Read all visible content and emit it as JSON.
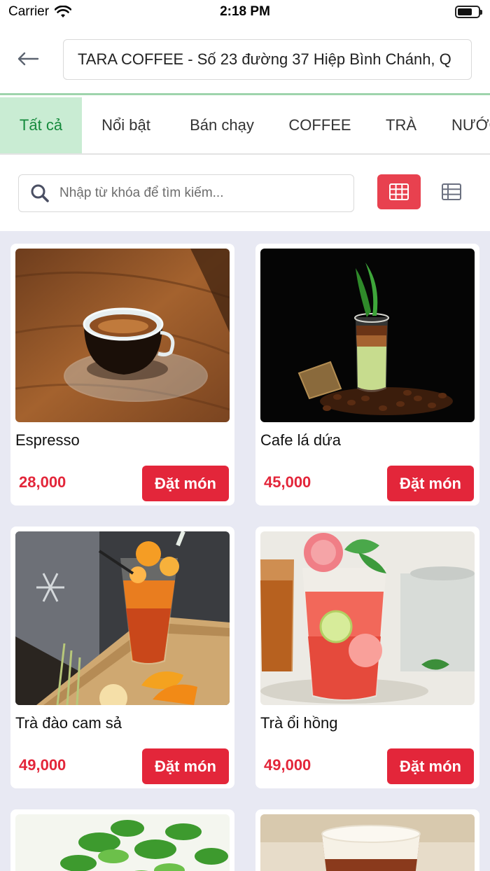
{
  "status_bar": {
    "carrier": "Carrier",
    "time": "2:18 PM"
  },
  "header": {
    "store": "TARA COFFEE - Số 23 đường 37 Hiệp Bình Chánh, Q"
  },
  "tabs": [
    {
      "label": "Tất cả",
      "active": true
    },
    {
      "label": "Nổi bật"
    },
    {
      "label": "Bán chạy"
    },
    {
      "label": "COFFEE"
    },
    {
      "label": "TRÀ"
    },
    {
      "label": "NƯỚC"
    }
  ],
  "search": {
    "placeholder": "Nhập từ khóa để tìm kiếm..."
  },
  "products": [
    {
      "name": "Espresso",
      "price": "28,000",
      "button": "Đặt món",
      "image": "espresso-cup-photo"
    },
    {
      "name": "Cafe lá dứa",
      "price": "45,000",
      "button": "Đặt món",
      "image": "pandan-coffee-photo"
    },
    {
      "name": "Trà đào cam sả",
      "price": "49,000",
      "button": "Đặt món",
      "image": "peach-orange-tea-photo"
    },
    {
      "name": "Trà ổi hồng",
      "price": "49,000",
      "button": "Đặt món",
      "image": "guava-tea-photo"
    }
  ],
  "colors": {
    "accent": "#e3263a",
    "tab_active_bg": "#c9ecd3",
    "tab_active_text": "#158a3c",
    "page_bg": "#e8e9f3"
  },
  "icons": [
    "back-arrow-icon",
    "search-icon",
    "grid-view-icon",
    "list-view-icon",
    "wifi-icon",
    "battery-icon"
  ]
}
